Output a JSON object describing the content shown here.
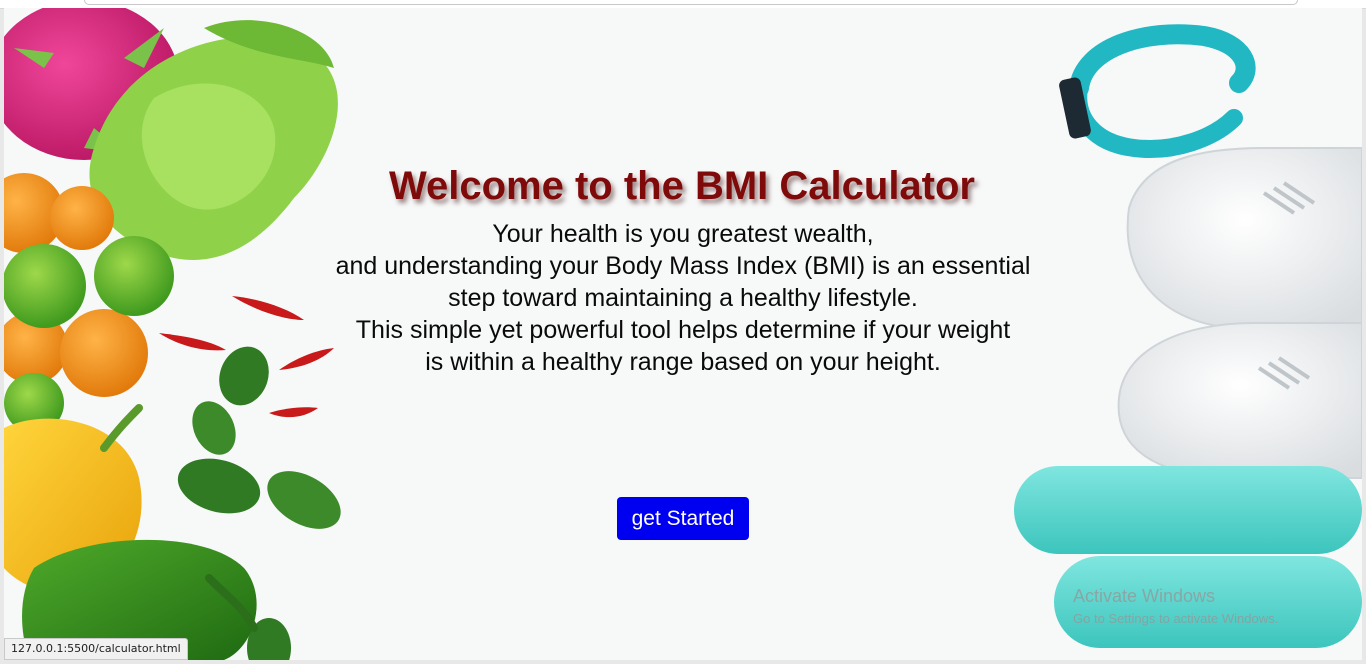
{
  "hero": {
    "title": "Welcome to the BMI Calculator",
    "lines": [
      "Your health is you greatest wealth,",
      "and understanding your Body Mass Index (BMI) is an essential",
      "step toward maintaining a healthy lifestyle.",
      "This simple yet powerful tool helps determine if your weight",
      "is within a healthy range based on your height."
    ],
    "button_label": "get Started"
  },
  "os_watermark": {
    "title": "Activate Windows",
    "subtitle": "Go to Settings to activate Windows."
  },
  "status_bar": {
    "url": "127.0.0.1:5500/calculator.html"
  },
  "colors": {
    "title": "#7f0a0a",
    "button": "#0000f0",
    "background": "#f7f8f8"
  }
}
